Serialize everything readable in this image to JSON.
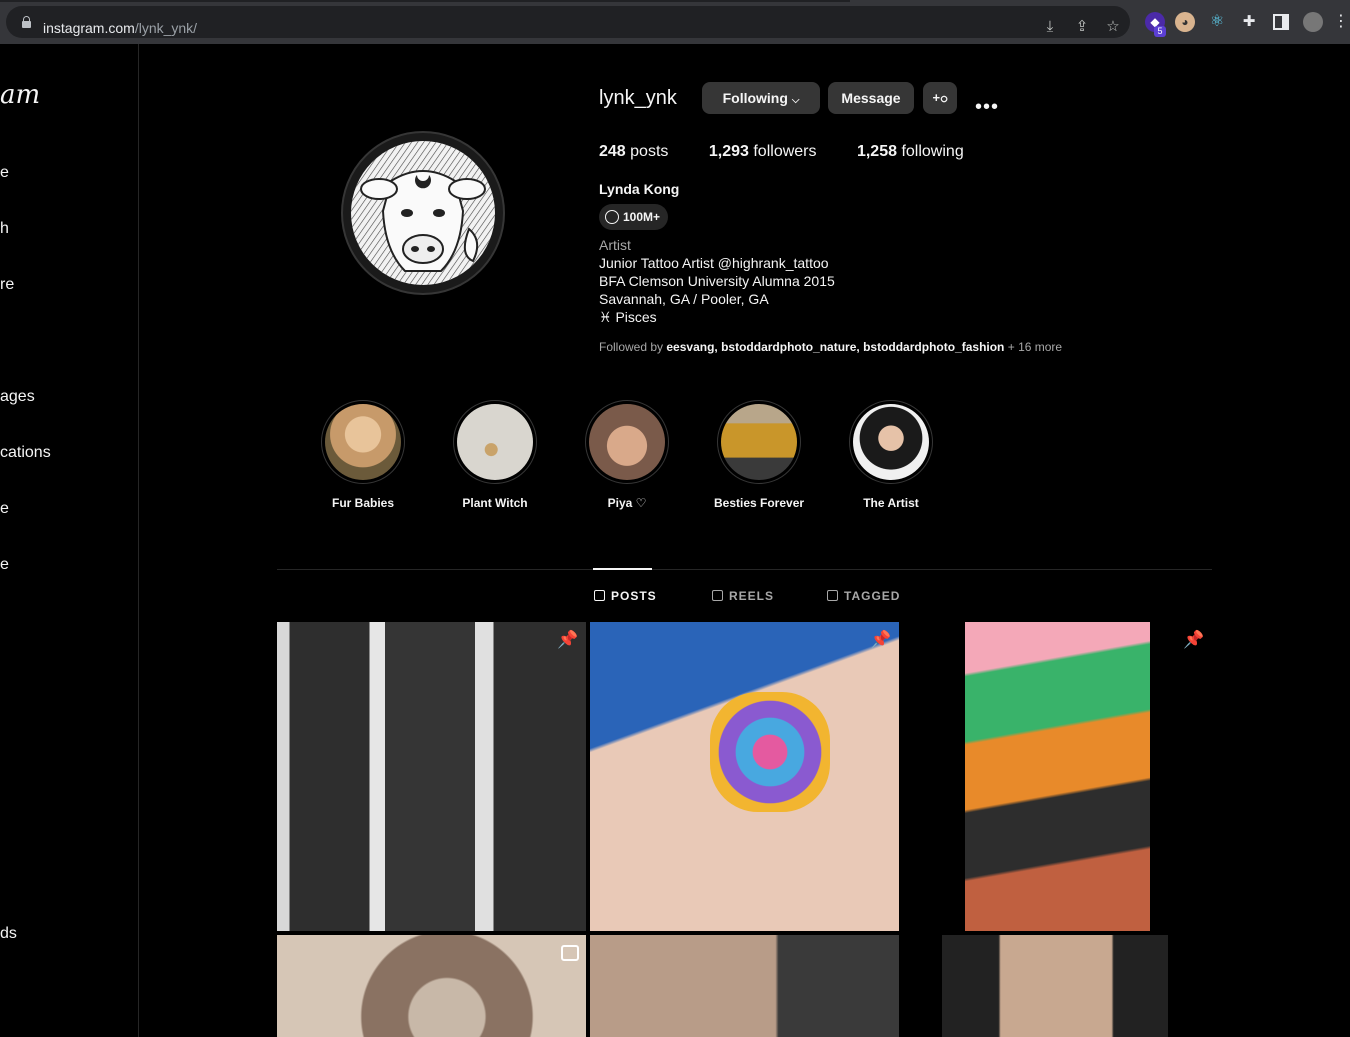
{
  "browser": {
    "url_domain": "instagram.com",
    "url_path": "/lynk_ynk/",
    "extension_badge": "5"
  },
  "sidebar": {
    "logo_fragment": "am",
    "items": [
      "e",
      "h",
      "re",
      "ages",
      "cations",
      "e",
      "e",
      "ds"
    ]
  },
  "profile": {
    "username": "lynk_ynk",
    "following_button": "Following",
    "message_button": "Message",
    "more_glyph": "•••",
    "posts_count": "248",
    "posts_label": "posts",
    "followers_count": "1,293",
    "followers_label": "followers",
    "following_count": "1,258",
    "following_label": "following",
    "full_name": "Lynda Kong",
    "threads_badge": "100M+",
    "category": "Artist",
    "bio_lines": [
      "Junior Tattoo Artist @highrank_tattoo",
      "BFA Clemson University Alumna 2015",
      "Savannah, GA / Pooler, GA",
      "♓  Pisces"
    ],
    "followed_by_prefix": "Followed by",
    "followed_by_names": "eesvang, bstoddardphoto_nature, bstoddardphoto_fashion",
    "followed_by_more": "+ 16 more"
  },
  "highlights": [
    {
      "label": "Fur Babies"
    },
    {
      "label": "Plant Witch"
    },
    {
      "label": "Piya ♡"
    },
    {
      "label": "Besties Forever"
    },
    {
      "label": "The Artist"
    }
  ],
  "tabs": [
    {
      "label": "POSTS"
    },
    {
      "label": "REELS"
    },
    {
      "label": "TAGGED"
    }
  ]
}
